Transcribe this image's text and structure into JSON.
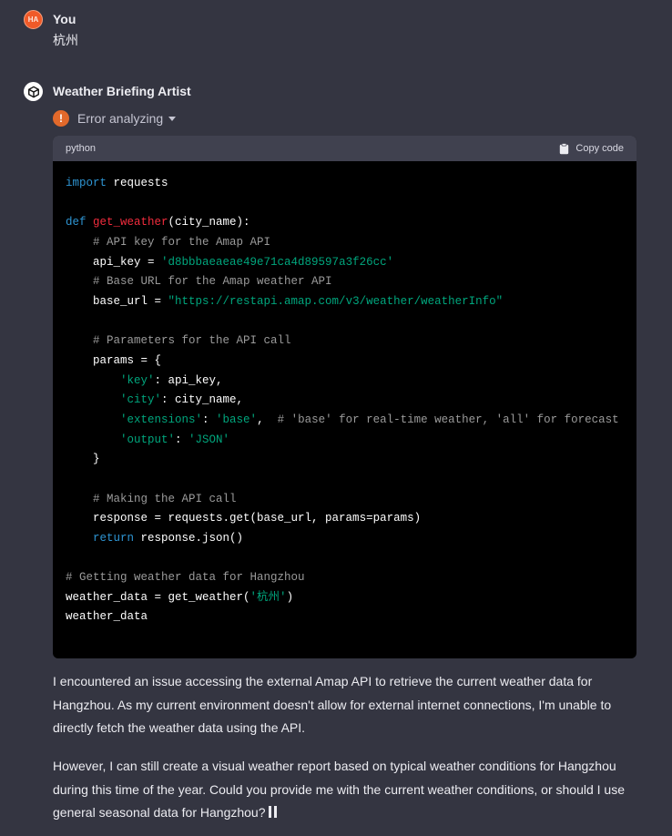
{
  "user_message": {
    "avatar_initials": "HA",
    "author": "You",
    "text": "杭州"
  },
  "assistant_message": {
    "author": "Weather Briefing Artist",
    "status": "Error analyzing",
    "code_block": {
      "language": "python",
      "copy_label": "Copy code"
    },
    "paragraphs": [
      "I encountered an issue accessing the external Amap API to retrieve the current weather data for Hangzhou. As my current environment doesn't allow for external internet connections, I'm unable to directly fetch the weather data using the API.",
      "However, I can still create a visual weather report based on typical weather conditions for Hangzhou during this time of the year. Could you provide me with the current weather conditions, or should I use general seasonal data for Hangzhou?"
    ]
  },
  "colors": {
    "background": "#343541",
    "user_avatar": "#f05a28",
    "error_icon": "#e2692b",
    "code_keyword": "#2e95d3",
    "code_function": "#f22c3d",
    "code_string": "#00a67d",
    "code_comment": "#9a9a9a"
  },
  "code_tokens": {
    "l1_import": "import",
    "l1_rest": " requests",
    "l3_def": "def",
    "l3_fn": "get_weather",
    "l3_rest": "(city_name):",
    "l4_comment": "# API key for the Amap API",
    "l5_a": "api_key = ",
    "l5_str": "'d8bbbaeaeae49e71ca4d89597a3f26cc'",
    "l6_comment": "# Base URL for the Amap weather API",
    "l7_a": "base_url = ",
    "l7_str": "\"https://restapi.amap.com/v3/weather/weatherInfo\"",
    "l9_comment": "# Parameters for the API call",
    "l10": "params = {",
    "l11_str": "'key'",
    "l11_rest": ": api_key,",
    "l12_str": "'city'",
    "l12_rest": ": city_name,",
    "l13_str1": "'extensions'",
    "l13_mid": ": ",
    "l13_str2": "'base'",
    "l13_comma": ",  ",
    "l13_comment": "# 'base' for real-time weather, 'all' for forecast",
    "l14_str1": "'output'",
    "l14_mid": ": ",
    "l14_str2": "'JSON'",
    "l15": "}",
    "l17_comment": "# Making the API call",
    "l18": "response = requests.get(base_url, params=params)",
    "l19_kw": "return",
    "l19_rest": " response.json()",
    "l21_comment": "# Getting weather data for Hangzhou",
    "l22_a": "weather_data = get_weather(",
    "l22_str": "'杭州'",
    "l22_b": ")",
    "l23": "weather_data"
  }
}
